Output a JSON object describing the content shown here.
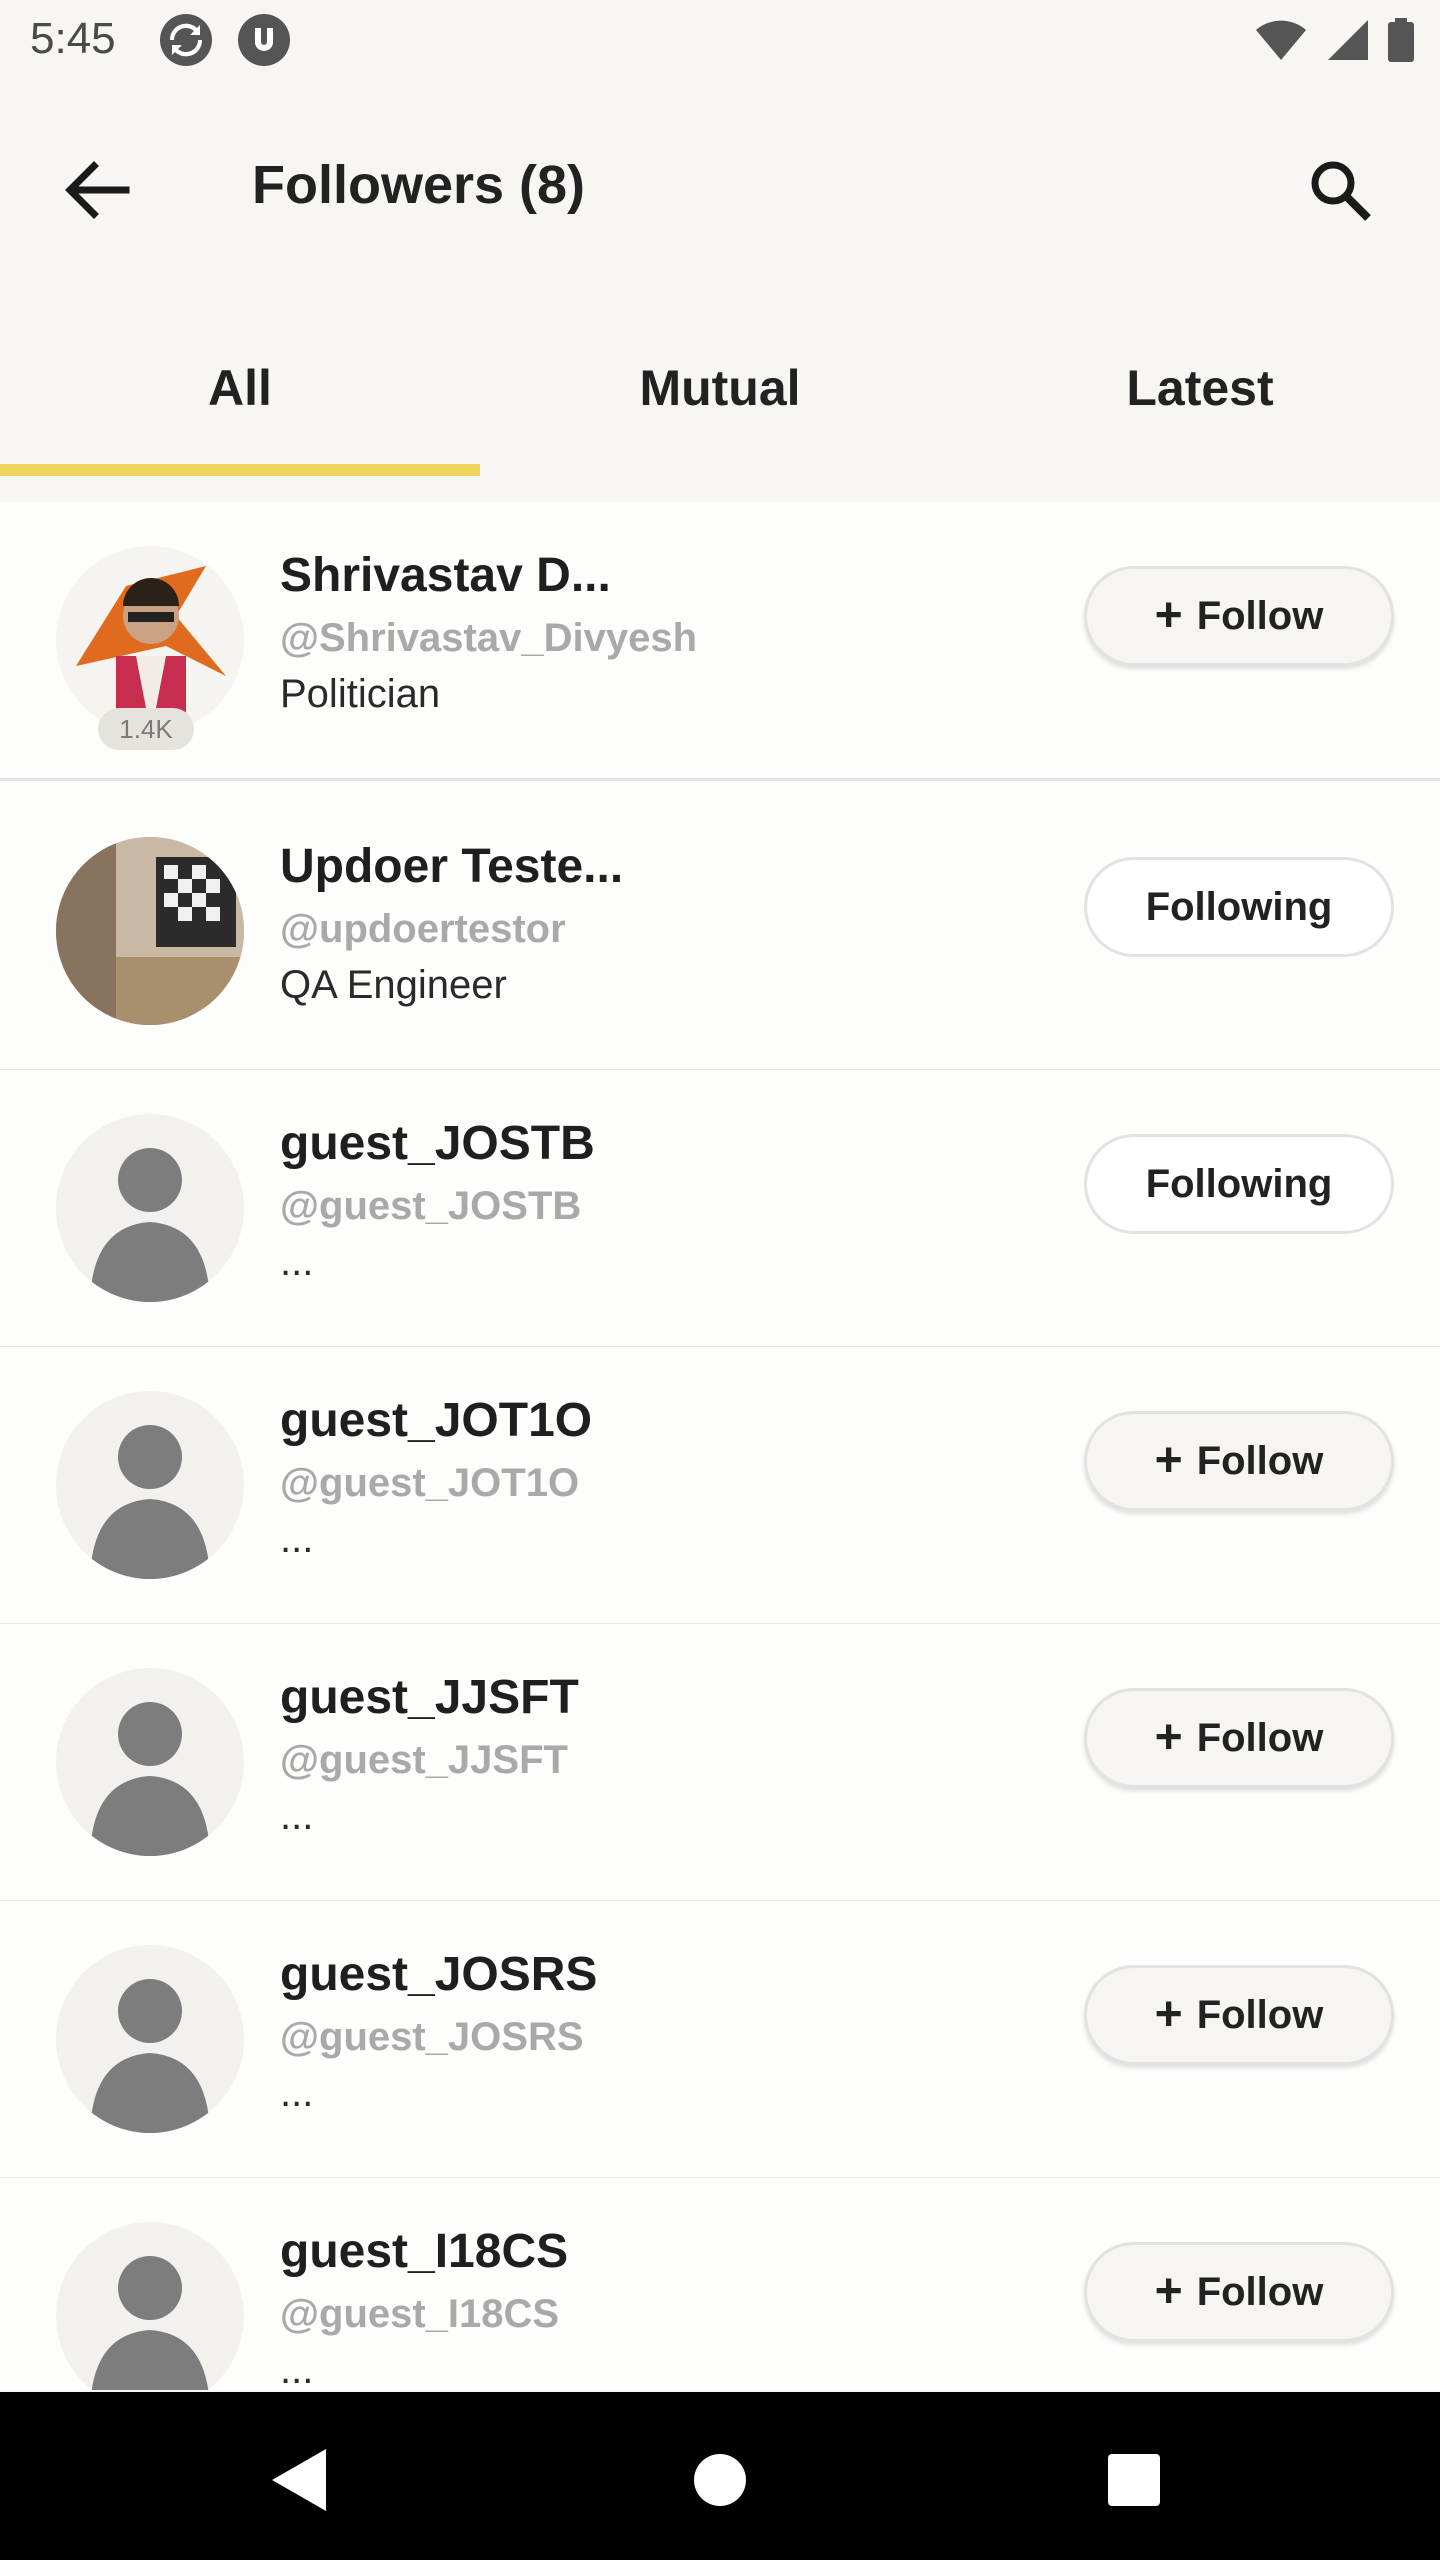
{
  "status_bar": {
    "time": "5:45",
    "icons": [
      "sync-icon",
      "app-u-icon",
      "wifi-icon",
      "signal-icon",
      "battery-icon"
    ]
  },
  "header": {
    "title": "Followers (8)",
    "back_icon": "back-arrow-icon",
    "search_icon": "search-icon"
  },
  "tabs": [
    {
      "label": "All",
      "active": true
    },
    {
      "label": "Mutual",
      "active": false
    },
    {
      "label": "Latest",
      "active": false
    }
  ],
  "colors": {
    "accent": "#efd35a",
    "background": "#f7f6f2"
  },
  "followers": [
    {
      "name": "Shrivastav D...",
      "handle": "@Shrivastav_Divyesh",
      "bio": "Politician",
      "badge": "1.4K",
      "button": "Follow",
      "avatar": "photo"
    },
    {
      "name": "Updoer Teste...",
      "handle": "@updoertestor",
      "bio": "QA Engineer",
      "button": "Following",
      "avatar": "photo"
    },
    {
      "name": "guest_JOSTB",
      "handle": "@guest_JOSTB",
      "bio": "...",
      "button": "Following",
      "avatar": "placeholder"
    },
    {
      "name": "guest_JOT1O",
      "handle": "@guest_JOT1O",
      "bio": "...",
      "button": "Follow",
      "avatar": "placeholder"
    },
    {
      "name": "guest_JJSFT",
      "handle": "@guest_JJSFT",
      "bio": "...",
      "button": "Follow",
      "avatar": "placeholder"
    },
    {
      "name": "guest_JOSRS",
      "handle": "@guest_JOSRS",
      "bio": "...",
      "button": "Follow",
      "avatar": "placeholder"
    },
    {
      "name": "guest_I18CS",
      "handle": "@guest_I18CS",
      "bio": "...",
      "button": "Follow",
      "avatar": "placeholder"
    }
  ],
  "nav_bar": {
    "icons": [
      "nav-back-icon",
      "nav-home-icon",
      "nav-recents-icon"
    ]
  }
}
